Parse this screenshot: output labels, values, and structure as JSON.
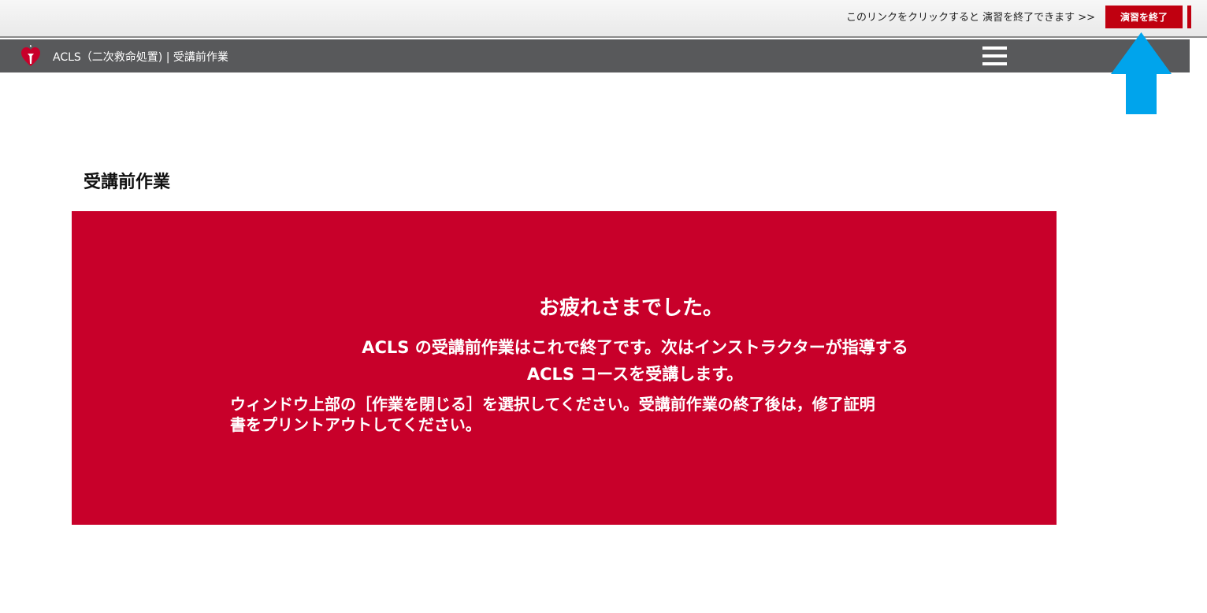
{
  "topbar": {
    "hint_text": "このリンクをクリックすると 演習を終了できます >>",
    "exit_button_label": "演習を終了"
  },
  "navbar": {
    "title": "ACLS（二次救命処置) | 受講前作業",
    "logo_icon": "heart-torch-logo-icon",
    "menu_icon": "hamburger-menu-icon"
  },
  "annotation": {
    "arrow_icon": "up-arrow-icon",
    "arrow_color": "#00a4ec"
  },
  "main": {
    "page_title": "受講前作業",
    "panel": {
      "heading": "お疲れさまでした。",
      "line1": "ACLS の受講前作業はこれで終了です。次はインストラクターが指導する",
      "line2": "ACLS コースを受講します。",
      "note": "ウィンドウ上部の［作業を閉じる］を選択してください。受講前作業の終了後は，修了証明書をプリントアウトしてください。"
    }
  },
  "colors": {
    "brand_red": "#c8002a",
    "button_red": "#c00010",
    "navbar_gray": "#58595b"
  }
}
